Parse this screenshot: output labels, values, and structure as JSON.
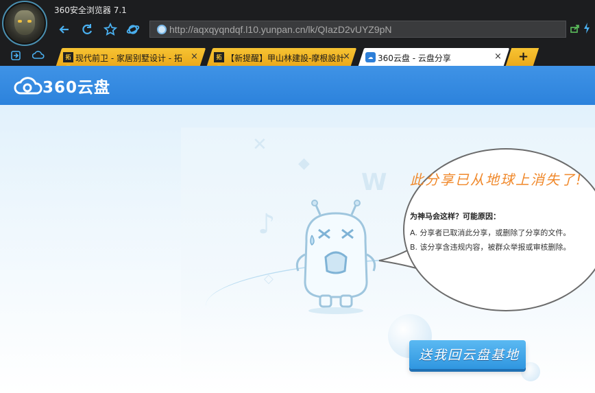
{
  "browser": {
    "app_title": "360安全浏览器 7.1",
    "url": "http://aqxqyqndqf.l10.yunpan.cn/lk/QIazD2vUYZ9pN",
    "tabs": [
      {
        "favicon_text": "拓者",
        "label": "现代前卫 - 家居别墅设计 - 拓",
        "active": false
      },
      {
        "favicon_text": "拓者",
        "label": "【新提醒】甲山林建設-摩根設計",
        "active": false
      },
      {
        "favicon_text": "",
        "label": "360云盘 - 云盘分享",
        "active": true
      }
    ],
    "new_tab_label": "+",
    "close_glyph": "×"
  },
  "page": {
    "logo_text": "360云盘",
    "error_title": "此分享已从地球上消失了!",
    "reason_heading": "为神马会这样？可能原因：",
    "reasons": [
      "A. 分享者已取消此分享，或删除了分享的文件。",
      "B. 该分享含违规内容，被群众举报或审核删除。"
    ],
    "home_button": "送我回云盘基地"
  },
  "colors": {
    "chrome_bg": "#1c1d1f",
    "tab_inactive": "#f2b92a",
    "header_blue": "#3a8fe3",
    "title_orange": "#f0882a",
    "button_blue": "#3ea3e8"
  },
  "icons": [
    "back-icon",
    "refresh-icon",
    "favorite-star-icon",
    "ie-icon",
    "globe-icon",
    "share-icon",
    "lightning-icon",
    "sidebar-login-icon",
    "cloud-icon",
    "close-icon",
    "plus-icon"
  ]
}
